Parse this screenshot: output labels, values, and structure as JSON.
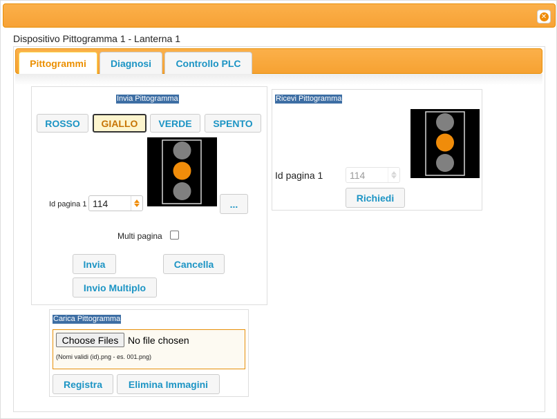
{
  "window": {
    "title": "Dispositivo Pittogramma 1 - Lanterna 1",
    "close_icon": "close-icon"
  },
  "tabs": [
    {
      "label": "Pittogrammi",
      "active": true
    },
    {
      "label": "Diagnosi",
      "active": false
    },
    {
      "label": "Controllo PLC",
      "active": false
    }
  ],
  "send_panel": {
    "title": "Invia Pittogramma",
    "color_buttons": [
      "ROSSO",
      "GIALLO",
      "VERDE",
      "SPENTO"
    ],
    "selected_color": "GIALLO",
    "page_id_label": "Id pagina 1",
    "page_id_value": "114",
    "browse_label": "...",
    "multi_page_label": "Multi pagina",
    "multi_page_checked": false,
    "send_label": "Invia",
    "cancel_label": "Cancella",
    "multi_send_label": "Invio Multiplo",
    "preview": {
      "lights": [
        "#808080",
        "#f08c0a",
        "#808080"
      ]
    }
  },
  "receive_panel": {
    "title": "Ricevi Pittogramma",
    "page_id_label": "Id pagina 1",
    "page_id_value": "114",
    "request_label": "Richiedi",
    "preview": {
      "lights": [
        "#808080",
        "#f08c0a",
        "#808080"
      ]
    }
  },
  "upload_panel": {
    "title": "Carica Pittogramma",
    "choose_label": "Choose Files",
    "no_file_text": "No file chosen",
    "hint": "(Nomi validi (id).png - es. 001.png)",
    "register_label": "Registra",
    "delete_label": "Elimina Immagini"
  },
  "colors": {
    "accent": "#f7a236",
    "link_blue": "#1c94c4",
    "title_blue": "#3d6ea4"
  }
}
